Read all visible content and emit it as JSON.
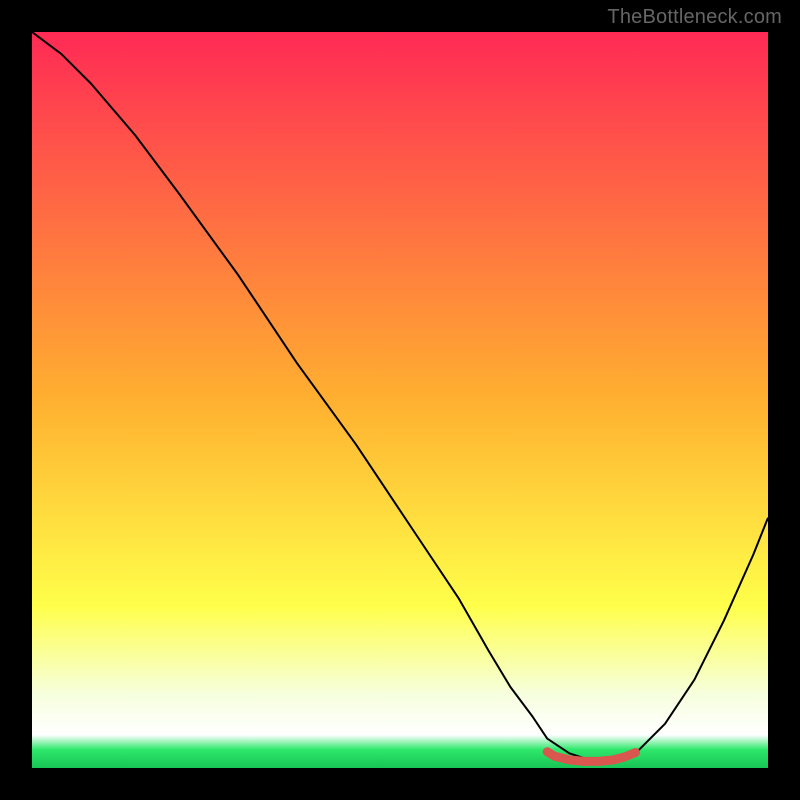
{
  "watermark": "TheBottleneck.com",
  "chart_data": {
    "type": "line",
    "title": "",
    "xlabel": "",
    "ylabel": "",
    "xlim": [
      0,
      100
    ],
    "ylim": [
      0,
      100
    ],
    "background_gradient": {
      "stops": [
        {
          "offset": 0.0,
          "color": "#ff2a55"
        },
        {
          "offset": 0.5,
          "color": "#ffb030"
        },
        {
          "offset": 0.78,
          "color": "#ffff4a"
        },
        {
          "offset": 0.9,
          "color": "#f6ffde"
        },
        {
          "offset": 0.955,
          "color": "#ffffff"
        },
        {
          "offset": 0.975,
          "color": "#2ee86b"
        },
        {
          "offset": 1.0,
          "color": "#17c455"
        }
      ]
    },
    "series": [
      {
        "name": "bottleneck-curve",
        "color": "#000000",
        "width": 2,
        "x": [
          0,
          4,
          8,
          14,
          20,
          28,
          36,
          44,
          52,
          58,
          62,
          65,
          68,
          70,
          73,
          76,
          79,
          82,
          86,
          90,
          94,
          98,
          100
        ],
        "y": [
          100,
          97,
          93,
          86,
          78,
          67,
          55,
          44,
          32,
          23,
          16,
          11,
          7,
          4,
          2,
          1,
          1,
          2,
          6,
          12,
          20,
          29,
          34
        ]
      },
      {
        "name": "optimal-band",
        "color": "#d9574e",
        "width": 9,
        "linecap": "round",
        "x": [
          70,
          71,
          73,
          75,
          77,
          79,
          80.5,
          82
        ],
        "y": [
          2.2,
          1.6,
          1.1,
          0.9,
          0.9,
          1.1,
          1.5,
          2.1
        ]
      }
    ]
  }
}
